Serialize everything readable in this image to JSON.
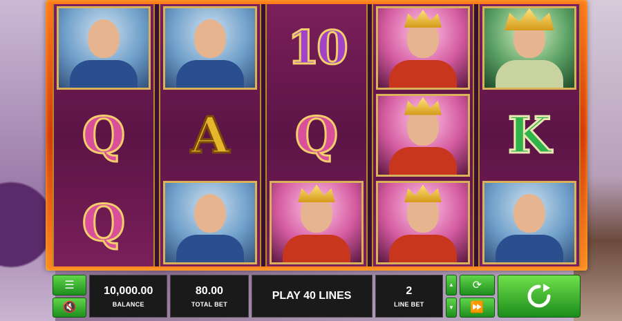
{
  "reels": [
    [
      "monk",
      "Q",
      "Q"
    ],
    [
      "monk",
      "A",
      "monk"
    ],
    [
      "10",
      "Q",
      "king"
    ],
    [
      "king",
      "king",
      "king"
    ],
    [
      "queen",
      "K",
      "monk"
    ]
  ],
  "controls": {
    "balance_value": "10,000.00",
    "balance_label": "BALANCE",
    "total_bet_value": "80.00",
    "total_bet_label": "TOTAL BET",
    "play_lines_label": "PLAY 40 LINES",
    "line_bet_value": "2",
    "line_bet_label": "LINE BET"
  },
  "icons": {
    "menu": "menu-icon",
    "sound": "mute-icon",
    "bet_up": "arrow-up-icon",
    "bet_down": "arrow-down-icon",
    "autoplay": "autoplay-icon",
    "fast": "fast-forward-icon",
    "spin": "spin-icon"
  },
  "colors": {
    "button_green": "#2fae2a",
    "frame_orange": "#e8551a",
    "reel_purple": "#6a1a50",
    "panel_dark": "#1a1a1a"
  }
}
